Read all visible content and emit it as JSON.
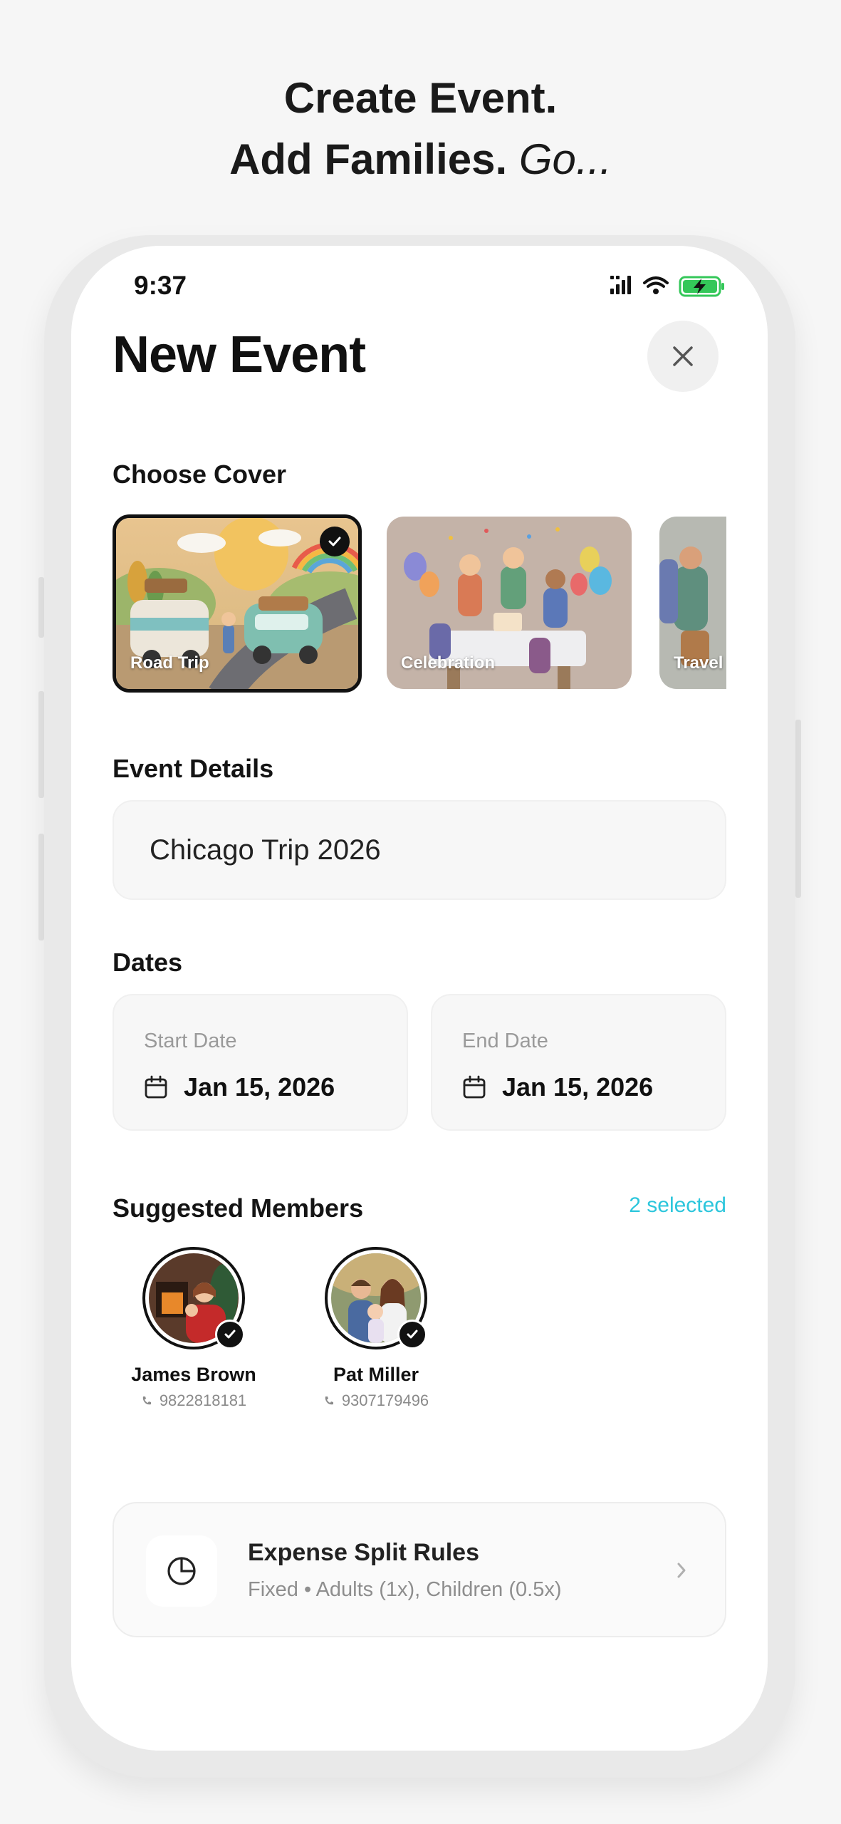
{
  "headline": {
    "line1": "Create Event.",
    "line2_bold": "Add Families.",
    "line2_italic": "Go..."
  },
  "status_bar": {
    "time": "9:37",
    "icons": [
      "signal-icon",
      "wifi-icon",
      "battery-charging-icon"
    ],
    "battery_color": "#34c759"
  },
  "header": {
    "title": "New Event",
    "close_icon": "close-icon"
  },
  "cover": {
    "label": "Choose Cover",
    "options": [
      {
        "title": "Road Trip",
        "selected": true
      },
      {
        "title": "Celebration",
        "selected": false
      },
      {
        "title": "Travel",
        "selected": false
      }
    ]
  },
  "details": {
    "label": "Event Details",
    "event_name": "Chicago Trip 2026"
  },
  "dates": {
    "label": "Dates",
    "start_label": "Start Date",
    "start_value": "Jan 15, 2026",
    "end_label": "End Date",
    "end_value": "Jan 15, 2026",
    "icon": "calendar-icon"
  },
  "members": {
    "label": "Suggested Members",
    "selected_count": "2 selected",
    "accent": "#2cc6dc",
    "items": [
      {
        "name": "James Brown",
        "phone": "9822818181",
        "selected": true
      },
      {
        "name": "Pat Miller",
        "phone": "9307179496",
        "selected": true
      }
    ]
  },
  "expense": {
    "title": "Expense Split Rules",
    "subtitle": "Fixed • Adults (1x), Children (0.5x)",
    "icon": "pie-chart-icon"
  }
}
